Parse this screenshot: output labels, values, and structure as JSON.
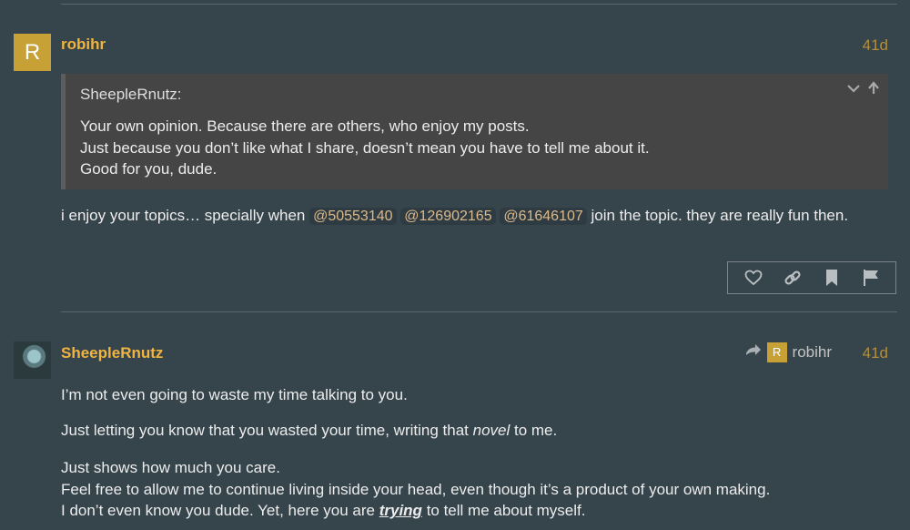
{
  "post1": {
    "avatar_letter": "R",
    "username": "robihr",
    "date": "41d",
    "quote": {
      "author": "SheepleRnutz:",
      "lines": [
        "Your own opinion. Because there are others, who enjoy my posts.",
        "Just because you don’t like what I share, doesn’t mean you have to tell me about it.",
        "Good for you, dude."
      ]
    },
    "body_prefix": "i enjoy your topics… specially when",
    "mentions": [
      "@50553140",
      "@126902165",
      "@61646107"
    ],
    "body_suffix": "join the topic. they are really fun then.",
    "actions": [
      "heart-icon",
      "link-icon",
      "bookmark-icon",
      "flag-icon"
    ]
  },
  "post2": {
    "username": "SheepleRnutz",
    "reply_to": {
      "avatar_letter": "R",
      "name": "robihr"
    },
    "date": "41d",
    "p1": "I’m not even going to waste my time talking to you.",
    "p2": {
      "before": "Just letting you know that you wasted your time, writing that",
      "em": "novel",
      "after": "to me."
    },
    "p3_line1": "Just shows how much you care.",
    "p3_line2": "Feel free to allow me to continue living inside your head, even though it’s a product of your own making.",
    "p3_line3": {
      "before": "I don’t even know you dude. Yet, here you are",
      "em": "trying",
      "after": "to tell me about myself."
    }
  },
  "colors": {
    "background": "#36444c",
    "username": "#f0b43f",
    "accent_avatar": "#c7a136",
    "date": "#b58f3a"
  }
}
